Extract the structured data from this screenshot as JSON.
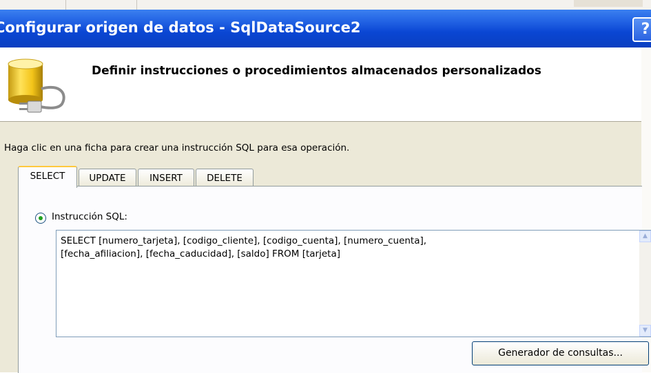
{
  "window": {
    "title": "Configurar origen de datos - SqlDataSource2",
    "help_label": "?"
  },
  "header": {
    "title": "Definir instrucciones o procedimientos almacenados personalizados",
    "icon": "database-icon"
  },
  "instruction": "Haga clic en una ficha para crear una instrucción SQL para esa operación.",
  "tabs": [
    {
      "label": "SELECT",
      "selected": true
    },
    {
      "label": "UPDATE",
      "selected": false
    },
    {
      "label": "INSERT",
      "selected": false
    },
    {
      "label": "DELETE",
      "selected": false
    }
  ],
  "select_tab": {
    "radio_label": "Instrucción SQL:",
    "radio_selected": true,
    "sql_text": "SELECT [numero_tarjeta], [codigo_cliente], [codigo_cuenta], [numero_cuenta],\n[fecha_afiliacion], [fecha_caducidad], [saldo] FROM [tarjeta]",
    "query_builder_label": "Generador de consultas..."
  },
  "colors": {
    "titlebar": "#0a46d3",
    "dialog_background": "#ece9d8",
    "tab_highlight": "#ffc83c"
  }
}
